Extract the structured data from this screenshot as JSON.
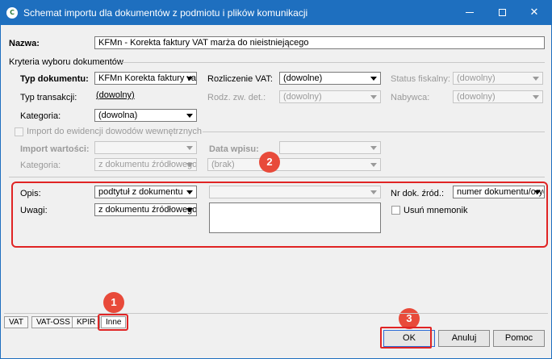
{
  "window": {
    "title": "Schemat importu dla dokumentów z podmiotu i plików komunikacji",
    "app_icon": "app-logo-icon",
    "controls": {
      "minimize": "minimize-icon",
      "maximize": "maximize-icon",
      "close_glyph": "✕"
    }
  },
  "header": {
    "name_label": "Nazwa:",
    "name_value": "KFMn - Korekta faktury VAT marża do nieistniejącego"
  },
  "criteria": {
    "section_label": "Kryteria wyboru dokumentów",
    "doc_type_label": "Typ dokumentu:",
    "doc_type_value": "KFMn Korekta faktury vat",
    "transaction_type_label": "Typ transakcji:",
    "transaction_type_value": "(dowolny)",
    "category_label": "Kategoria:",
    "category_value": "(dowolna)",
    "vat_settlement_label": "Rozliczenie VAT:",
    "vat_settlement_value": "(dowolne)",
    "fiscal_status_label": "Status fiskalny:",
    "fiscal_status_value": "(dowolny)",
    "doc_kind_label": "Rodz. zw. det.:",
    "doc_kind_value": "(dowolny)",
    "buyer_label": "Nabywca:",
    "buyer_value": "(dowolny)"
  },
  "internal_import": {
    "checkbox_label": "Import do ewidencji dowodów wewnętrznych",
    "import_values_label": "Import wartości:",
    "import_values_value": "",
    "entry_date_label": "Data wpisu:",
    "entry_date_value": "",
    "category_label": "Kategoria:",
    "category_value": "z dokumentu źródłowego",
    "extra_value": "(brak)"
  },
  "description": {
    "desc_label": "Opis:",
    "desc_value": "podtytuł z dokumentu",
    "desc_extra_value": "",
    "notes_label": "Uwagi:",
    "notes_value": "z dokumentu źródłowego",
    "source_doc_label": "Nr dok. źród.:",
    "source_doc_value": "numer dokumentu/oryg",
    "remove_mnemonic_label": "Usuń mnemonik"
  },
  "badges": [
    "1",
    "2",
    "3"
  ],
  "tabs": [
    "VAT",
    "VAT-OSS",
    "KPIR",
    "Inne"
  ],
  "buttons": {
    "ok": "OK",
    "cancel": "Anuluj",
    "help": "Pomoc"
  },
  "colors": {
    "titlebar": "#1e6fbf",
    "highlight": "#e02424",
    "badge": "#e84a3a"
  }
}
